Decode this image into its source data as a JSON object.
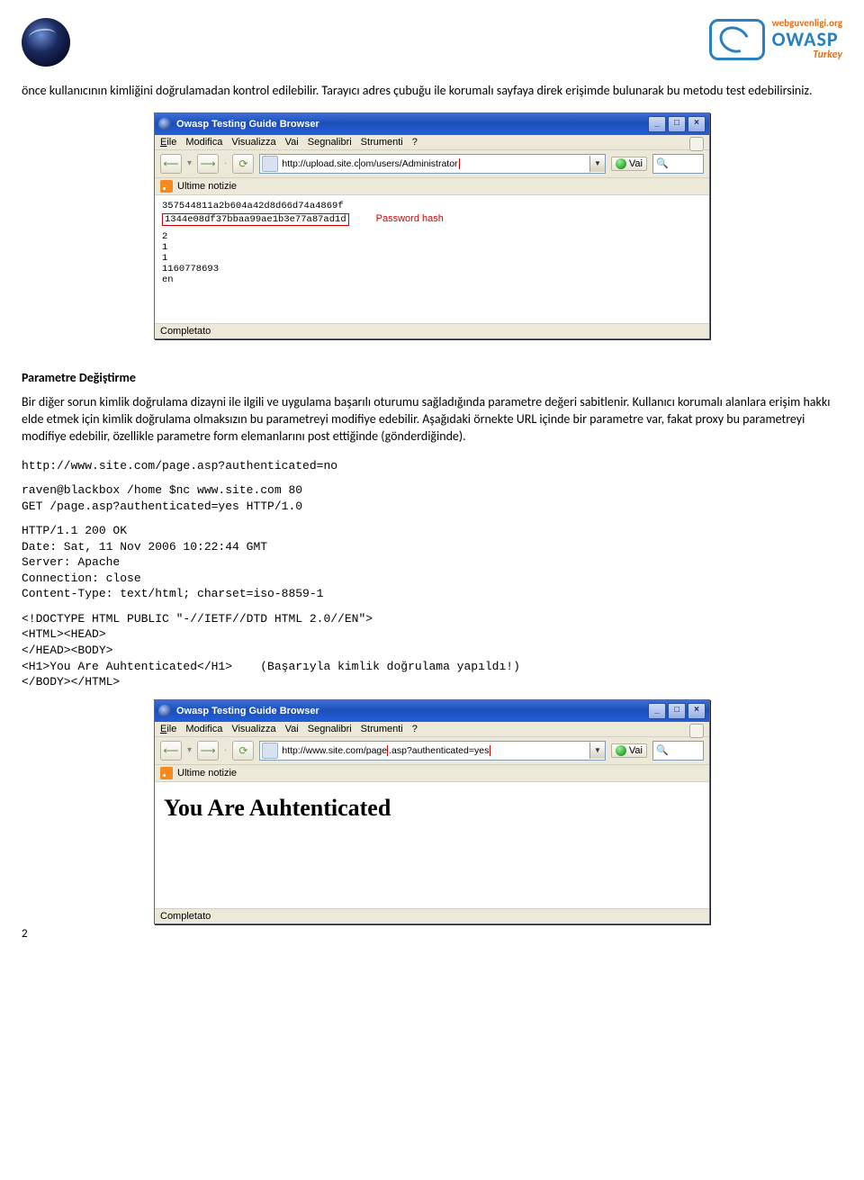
{
  "header": {
    "owasp_url": "webguvenligi.org",
    "owasp_name": "OWASP",
    "owasp_sub": "Turkey"
  },
  "intro_text": "önce kullanıcının kimliğini doğrulamadan kontrol edilebilir. Tarayıcı adres çubuğu ile korumalı sayfaya direk erişimde bulunarak bu metodu test edebilirsiniz.",
  "browser1": {
    "title": "Owasp Testing Guide Browser",
    "menu": [
      "Eile",
      "Modifica",
      "Visualizza",
      "Vai",
      "Segnalibri",
      "Strumenti",
      "?"
    ],
    "url_pre": "http://upload.site.c",
    "url_highlight": "om/users/Administrator",
    "go_label": "Vai",
    "linkbar": "Ultime notizie",
    "hash1": "357544811a2b604a42d8d66d74a4869f",
    "hash2": "1344e08df37bbaa99ae1b3e77a87ad1d",
    "pw_label": "Password hash",
    "lines": [
      "2",
      "1",
      "",
      "1",
      "1160778693",
      "en"
    ],
    "status": "Completato"
  },
  "section_title": "Parametre Değiştirme",
  "section_p1": "Bir diğer sorun kimlik doğrulama dizayni ile ilgili ve uygulama başarılı oturumu sağladığında parametre değeri sabitlenir. Kullanıcı korumalı alanlara erişim hakkı elde etmek için kimlik doğrulama olmaksızın bu parametreyi modifiye edebilir. Aşağıdaki örnekte URL içinde bir parametre var, fakat proxy bu parametreyi modifiye edebilir, özellikle parametre form elemanlarını post ettiğinde (gönderdiğinde).",
  "code": {
    "url_line": "http://www.site.com/page.asp?authenticated=no",
    "block1": "raven@blackbox /home $nc www.site.com 80\nGET /page.asp?authenticated=yes HTTP/1.0",
    "block2": "HTTP/1.1 200 OK\nDate: Sat, 11 Nov 2006 10:22:44 GMT\nServer: Apache\nConnection: close\nContent-Type: text/html; charset=iso-8859-1",
    "block3": "<!DOCTYPE HTML PUBLIC \"-//IETF//DTD HTML 2.0//EN\">\n<HTML><HEAD>\n</HEAD><BODY>\n<H1>You Are Auhtenticated</H1>    (Başarıyla kimlik doğrulama yapıldı!)\n</BODY></HTML>"
  },
  "browser2": {
    "title": "Owasp Testing Guide Browser",
    "menu": [
      "Eile",
      "Modifica",
      "Visualizza",
      "Vai",
      "Segnalibri",
      "Strumenti",
      "?"
    ],
    "url_pre": "http://www.site.com/page",
    "url_highlight": ".asp?authenticated=yes",
    "go_label": "Vai",
    "linkbar": "Ultime notizie",
    "heading": "You Are Auhtenticated",
    "status": "Completato"
  },
  "page_number": "2"
}
